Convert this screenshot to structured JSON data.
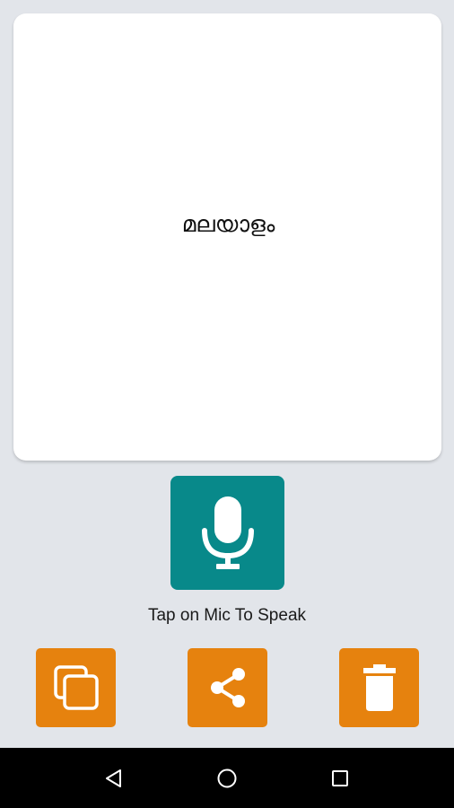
{
  "card": {
    "text": "മലയാളം"
  },
  "mic": {
    "icon": "microphone-icon",
    "color": "#08898a"
  },
  "hint": {
    "text": "Tap on Mic To Speak"
  },
  "actions": [
    {
      "icon": "copy-icon",
      "color": "#e6820e"
    },
    {
      "icon": "share-icon",
      "color": "#e6820e"
    },
    {
      "icon": "trash-icon",
      "color": "#e6820e"
    }
  ],
  "navbar": {
    "items": [
      "back-icon",
      "home-icon",
      "recents-icon"
    ]
  }
}
